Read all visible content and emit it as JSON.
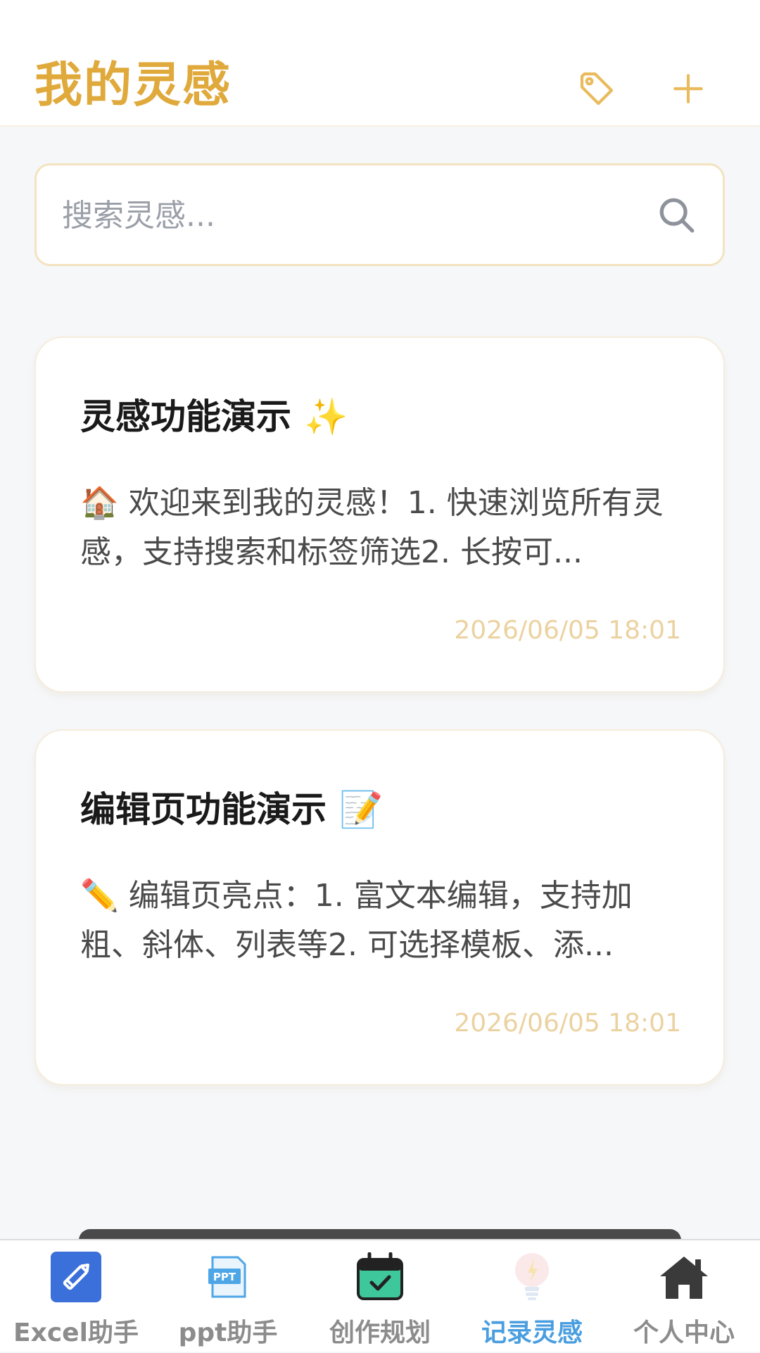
{
  "header": {
    "title": "我的灵感",
    "tag_icon": "tag-icon",
    "add_icon": "plus-icon"
  },
  "search": {
    "placeholder": "搜索灵感..."
  },
  "cards": [
    {
      "title": "灵感功能演示",
      "title_emoji": "✨",
      "body_emoji": "🏠",
      "body": "欢迎来到我的灵感！1. 快速浏览所有灵感，支持搜索和标签筛选2. 长按可...",
      "date": "2026/06/05 18:01"
    },
    {
      "title": "编辑页功能演示",
      "title_emoji": "📝",
      "body_emoji": "✏️",
      "body": "编辑页亮点：1. 富文本编辑，支持加粗、斜体、列表等2. 可选择模板、添...",
      "date": "2026/06/05 18:01"
    }
  ],
  "tabs": [
    {
      "label": "Excel助手",
      "icon": "pencil-icon"
    },
    {
      "label": "ppt助手",
      "icon": "ppt-icon"
    },
    {
      "label": "创作规划",
      "icon": "calendar-check-icon"
    },
    {
      "label": "记录灵感",
      "icon": "lightbulb-icon",
      "active": true
    },
    {
      "label": "个人中心",
      "icon": "home-icon"
    }
  ],
  "colors": {
    "accent": "#e0a93b",
    "active_tab": "#4a9ee0",
    "date": "#ebd2a0",
    "background": "#f6f7f9"
  }
}
